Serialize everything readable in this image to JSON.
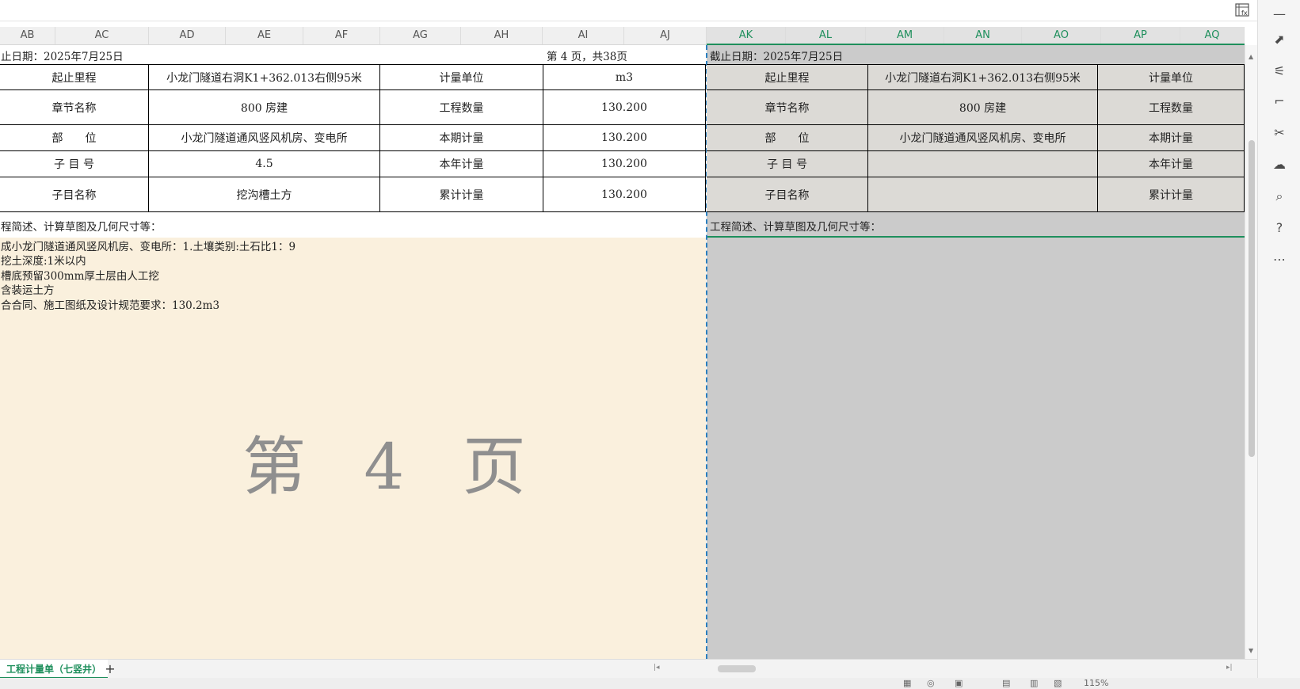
{
  "columns_left": [
    "AB",
    "AC",
    "AD",
    "AE",
    "AF",
    "AG",
    "AH",
    "AI",
    "AJ"
  ],
  "columns_right": [
    "AK",
    "AL",
    "AM",
    "AN",
    "AO",
    "AP",
    "AQ"
  ],
  "left": {
    "date_line": "止日期：2025年7月25日",
    "page_of": "第 4 页，共38页",
    "rows": [
      [
        "起止里程",
        "小龙门隧道右洞K1+362.013右侧95米",
        "计量单位",
        "m3"
      ],
      [
        "章节名称",
        "800 房建",
        "工程数量",
        "130.200"
      ],
      [
        "部　　位",
        "小龙门隧道通风竖风机房、变电所",
        "本期计量",
        "130.200"
      ],
      [
        "子 目 号",
        "4.5",
        "本年计量",
        "130.200"
      ],
      [
        "子目名称",
        "挖沟槽土方",
        "累计计量",
        "130.200"
      ]
    ],
    "desc_heading": "程简述、计算草图及几何尺寸等：",
    "desc_lines": [
      "成小龙门隧道通风竖风机房、变电所：1.土壤类别:土石比1：9",
      "挖土深度:1米以内",
      "槽底预留300mm厚土层由人工挖",
      "含装运土方",
      "合合同、施工图纸及设计规范要求：130.2m3"
    ],
    "watermark": "第 4 页"
  },
  "right": {
    "date_line": "截止日期：2025年7月25日",
    "rows": [
      [
        "起止里程",
        "小龙门隧道右洞K1+362.013右侧95米",
        "计量单位"
      ],
      [
        "章节名称",
        "800 房建",
        "工程数量"
      ],
      [
        "部　　位",
        "小龙门隧道通风竖风机房、变电所",
        "本期计量"
      ],
      [
        "子 目 号",
        "",
        "本年计量"
      ],
      [
        "子目名称",
        "",
        "累计计量"
      ]
    ],
    "desc_heading": "工程简述、计算草图及几何尺寸等："
  },
  "tabs": {
    "sheet_name": "工程计量单（七竖井）",
    "add": "+"
  },
  "status": {
    "zoom": "115%"
  },
  "sidebar_icons": [
    "select-icon",
    "settings-sliders-icon",
    "crop-icon",
    "tools-icon",
    "cloud-icon",
    "book-search-icon",
    "help-icon",
    "more-icon"
  ],
  "colors": {
    "accent": "#1e8f5c",
    "printed_bg": "#faf0dd",
    "right_bg": "#cbcbcb"
  }
}
